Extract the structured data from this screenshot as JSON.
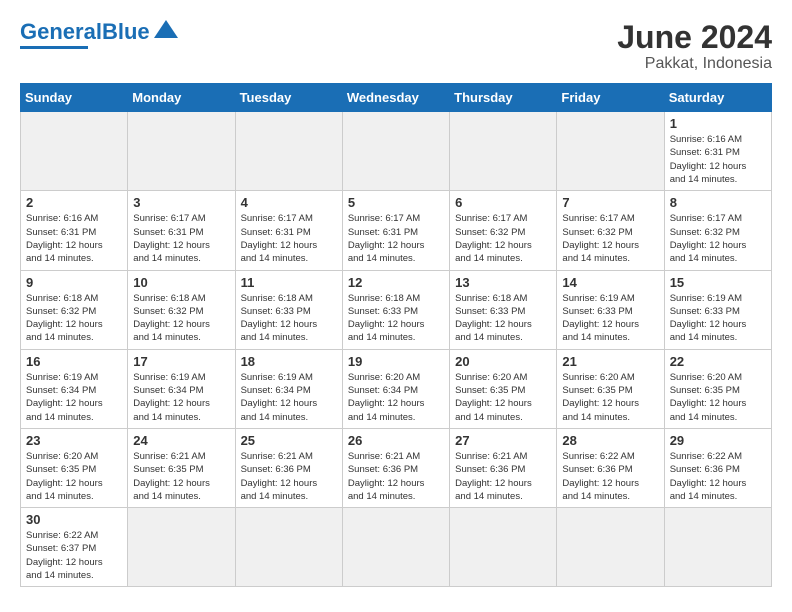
{
  "header": {
    "logo_general": "General",
    "logo_blue": "Blue",
    "month_year": "June 2024",
    "location": "Pakkat, Indonesia"
  },
  "weekdays": [
    "Sunday",
    "Monday",
    "Tuesday",
    "Wednesday",
    "Thursday",
    "Friday",
    "Saturday"
  ],
  "days": [
    {
      "date": "",
      "info": ""
    },
    {
      "date": "",
      "info": ""
    },
    {
      "date": "",
      "info": ""
    },
    {
      "date": "",
      "info": ""
    },
    {
      "date": "",
      "info": ""
    },
    {
      "date": "",
      "info": ""
    },
    {
      "date": "1",
      "info": "Sunrise: 6:16 AM\nSunset: 6:31 PM\nDaylight: 12 hours\nand 14 minutes."
    },
    {
      "date": "2",
      "info": "Sunrise: 6:16 AM\nSunset: 6:31 PM\nDaylight: 12 hours\nand 14 minutes."
    },
    {
      "date": "3",
      "info": "Sunrise: 6:17 AM\nSunset: 6:31 PM\nDaylight: 12 hours\nand 14 minutes."
    },
    {
      "date": "4",
      "info": "Sunrise: 6:17 AM\nSunset: 6:31 PM\nDaylight: 12 hours\nand 14 minutes."
    },
    {
      "date": "5",
      "info": "Sunrise: 6:17 AM\nSunset: 6:31 PM\nDaylight: 12 hours\nand 14 minutes."
    },
    {
      "date": "6",
      "info": "Sunrise: 6:17 AM\nSunset: 6:32 PM\nDaylight: 12 hours\nand 14 minutes."
    },
    {
      "date": "7",
      "info": "Sunrise: 6:17 AM\nSunset: 6:32 PM\nDaylight: 12 hours\nand 14 minutes."
    },
    {
      "date": "8",
      "info": "Sunrise: 6:17 AM\nSunset: 6:32 PM\nDaylight: 12 hours\nand 14 minutes."
    },
    {
      "date": "9",
      "info": "Sunrise: 6:18 AM\nSunset: 6:32 PM\nDaylight: 12 hours\nand 14 minutes."
    },
    {
      "date": "10",
      "info": "Sunrise: 6:18 AM\nSunset: 6:32 PM\nDaylight: 12 hours\nand 14 minutes."
    },
    {
      "date": "11",
      "info": "Sunrise: 6:18 AM\nSunset: 6:33 PM\nDaylight: 12 hours\nand 14 minutes."
    },
    {
      "date": "12",
      "info": "Sunrise: 6:18 AM\nSunset: 6:33 PM\nDaylight: 12 hours\nand 14 minutes."
    },
    {
      "date": "13",
      "info": "Sunrise: 6:18 AM\nSunset: 6:33 PM\nDaylight: 12 hours\nand 14 minutes."
    },
    {
      "date": "14",
      "info": "Sunrise: 6:19 AM\nSunset: 6:33 PM\nDaylight: 12 hours\nand 14 minutes."
    },
    {
      "date": "15",
      "info": "Sunrise: 6:19 AM\nSunset: 6:33 PM\nDaylight: 12 hours\nand 14 minutes."
    },
    {
      "date": "16",
      "info": "Sunrise: 6:19 AM\nSunset: 6:34 PM\nDaylight: 12 hours\nand 14 minutes."
    },
    {
      "date": "17",
      "info": "Sunrise: 6:19 AM\nSunset: 6:34 PM\nDaylight: 12 hours\nand 14 minutes."
    },
    {
      "date": "18",
      "info": "Sunrise: 6:19 AM\nSunset: 6:34 PM\nDaylight: 12 hours\nand 14 minutes."
    },
    {
      "date": "19",
      "info": "Sunrise: 6:20 AM\nSunset: 6:34 PM\nDaylight: 12 hours\nand 14 minutes."
    },
    {
      "date": "20",
      "info": "Sunrise: 6:20 AM\nSunset: 6:35 PM\nDaylight: 12 hours\nand 14 minutes."
    },
    {
      "date": "21",
      "info": "Sunrise: 6:20 AM\nSunset: 6:35 PM\nDaylight: 12 hours\nand 14 minutes."
    },
    {
      "date": "22",
      "info": "Sunrise: 6:20 AM\nSunset: 6:35 PM\nDaylight: 12 hours\nand 14 minutes."
    },
    {
      "date": "23",
      "info": "Sunrise: 6:20 AM\nSunset: 6:35 PM\nDaylight: 12 hours\nand 14 minutes."
    },
    {
      "date": "24",
      "info": "Sunrise: 6:21 AM\nSunset: 6:35 PM\nDaylight: 12 hours\nand 14 minutes."
    },
    {
      "date": "25",
      "info": "Sunrise: 6:21 AM\nSunset: 6:36 PM\nDaylight: 12 hours\nand 14 minutes."
    },
    {
      "date": "26",
      "info": "Sunrise: 6:21 AM\nSunset: 6:36 PM\nDaylight: 12 hours\nand 14 minutes."
    },
    {
      "date": "27",
      "info": "Sunrise: 6:21 AM\nSunset: 6:36 PM\nDaylight: 12 hours\nand 14 minutes."
    },
    {
      "date": "28",
      "info": "Sunrise: 6:22 AM\nSunset: 6:36 PM\nDaylight: 12 hours\nand 14 minutes."
    },
    {
      "date": "29",
      "info": "Sunrise: 6:22 AM\nSunset: 6:36 PM\nDaylight: 12 hours\nand 14 minutes."
    },
    {
      "date": "30",
      "info": "Sunrise: 6:22 AM\nSunset: 6:37 PM\nDaylight: 12 hours\nand 14 minutes."
    },
    {
      "date": "",
      "info": ""
    },
    {
      "date": "",
      "info": ""
    },
    {
      "date": "",
      "info": ""
    },
    {
      "date": "",
      "info": ""
    },
    {
      "date": "",
      "info": ""
    },
    {
      "date": "",
      "info": ""
    }
  ]
}
